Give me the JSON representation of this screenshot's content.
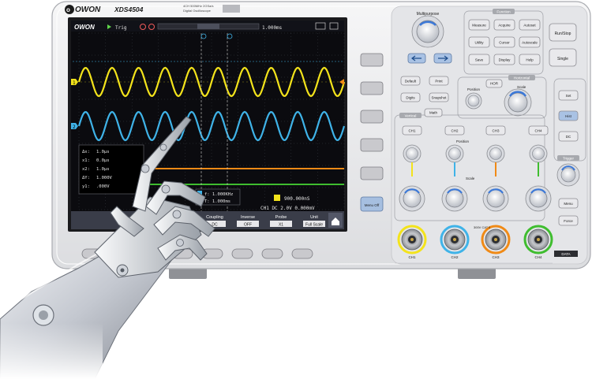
{
  "brand": {
    "logo": "OWON",
    "model": "XDS4504",
    "subtitle_line1": "4CH  500MHz  2GSa/s",
    "subtitle_line2": "Digital Oscilloscope"
  },
  "screen": {
    "top_bar": {
      "logo": "OWON",
      "run_state": "Trig",
      "timebase": "1.000ms"
    },
    "cursor_readouts": [
      {
        "label": "Δx:",
        "value": "1.0µs"
      },
      {
        "label": "x1:",
        "value": "0.0µs"
      },
      {
        "label": "x2:",
        "value": "1.0µs"
      },
      {
        "label": "ΔY:",
        "value": "1.000V"
      },
      {
        "label": "y1:",
        "value": ".000V"
      }
    ],
    "freq_box": {
      "line1": "f: 1.000KHz",
      "line2": "T: 1.000ms"
    },
    "status_right": "900.000nS",
    "bottom_status": "CH1 DC 2.0V   0.000mV",
    "ch1_marker": "1",
    "ch2_marker": "2",
    "softmenu": [
      {
        "title": "Coupling",
        "value": "DC"
      },
      {
        "title": "Inverse",
        "value": "OFF"
      },
      {
        "title": "Probe",
        "value": "X1"
      },
      {
        "title": "Unit",
        "value": "Full Scale"
      }
    ],
    "home_icon": "home-icon"
  },
  "side_keys": {
    "menu_off": "Menu Off"
  },
  "panel": {
    "multipurpose_label": "Multipurpose",
    "function_label": "Function",
    "function_keys": [
      "Measure",
      "Acquire",
      "Autoset",
      "Utility",
      "Cursor",
      "Autoscale",
      "Save",
      "Display",
      "Help"
    ],
    "run_stop": "Run/Stop",
    "single": "Single",
    "default_key": "Default",
    "print_key": "Print",
    "digits_key": "Digits",
    "snapshot_key": "Snapshot",
    "horizontal_label": "Horizontal",
    "horiz_menu": "HOR",
    "horiz_position": "Position",
    "horiz_scale": "Scale",
    "vertical_label": "Vertical",
    "math_key": "Math",
    "ch_keys": [
      "CH1",
      "CH2",
      "CH3",
      "CH4"
    ],
    "v_position": "Position",
    "v_scale": "Scale",
    "trigger_label": "Trigger",
    "trig_keys": [
      "Set",
      "Hist",
      "DC"
    ],
    "force_key": "Force",
    "menu_key": "Menu",
    "bnc_labels": [
      "CH1",
      "CH2",
      "CH3",
      "CH4"
    ],
    "bnc_warning": "300V CAT II",
    "right_tag": "DATA"
  },
  "colors": {
    "ch1": "#f3e31b",
    "ch2": "#3fb3e8",
    "ch3": "#f08a16",
    "ch4": "#3fbd2f",
    "screen_bg": "#0b0b0f",
    "bezel": "#ececee"
  }
}
